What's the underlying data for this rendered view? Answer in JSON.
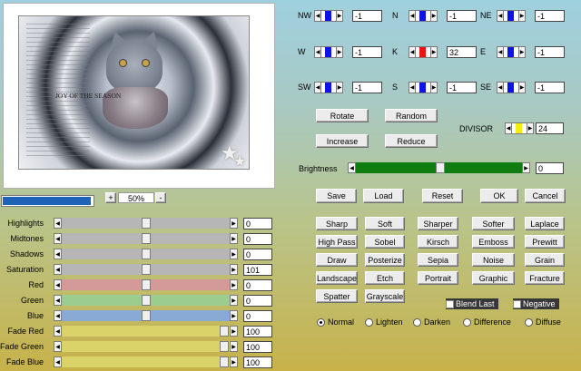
{
  "preview": {
    "art_title": "JOY OF THE SEASON",
    "progress": 0.98
  },
  "zoom": {
    "plus": "+",
    "value": "50%",
    "minus": "-"
  },
  "matrix": [
    {
      "label": "NW",
      "value": "-1",
      "thumb": "blue"
    },
    {
      "label": "N",
      "value": "-1",
      "thumb": "blue"
    },
    {
      "label": "NE",
      "value": "-1",
      "thumb": "blue"
    },
    {
      "label": "W",
      "value": "-1",
      "thumb": "blue"
    },
    {
      "label": "K",
      "value": "32",
      "thumb": "red"
    },
    {
      "label": "E",
      "value": "-1",
      "thumb": "blue"
    },
    {
      "label": "SW",
      "value": "-1",
      "thumb": "blue"
    },
    {
      "label": "S",
      "value": "-1",
      "thumb": "blue"
    },
    {
      "label": "SE",
      "value": "-1",
      "thumb": "blue"
    }
  ],
  "matrix_buttons": {
    "rotate": "Rotate",
    "random": "Random",
    "increase": "Increase",
    "reduce": "Reduce"
  },
  "divisor": {
    "label": "DIVISOR",
    "value": "24"
  },
  "brightness": {
    "label": "Brightness",
    "value": "0"
  },
  "actions": {
    "save": "Save",
    "load": "Load",
    "reset": "Reset",
    "ok": "OK",
    "cancel": "Cancel"
  },
  "presets": [
    "Sharp",
    "Soft",
    "Sharper",
    "Softer",
    "Laplace",
    "High Pass",
    "Sobel",
    "Kirsch",
    "Emboss",
    "Prewitt",
    "Draw",
    "Posterize",
    "Sepia",
    "Noise",
    "Grain",
    "Landscape",
    "Etch",
    "Portrait",
    "Graphic",
    "Fracture",
    "Spatter",
    "Grayscale"
  ],
  "options": {
    "blend_last": "Blend Last",
    "negative": "Negative"
  },
  "blend_modes": [
    "Normal",
    "Lighten",
    "Darken",
    "Difference",
    "Diffuse"
  ],
  "selected_mode": "Normal",
  "adjustments": [
    {
      "label": "Highlights",
      "value": "0",
      "level": 0.5,
      "color": "#b6b6b6"
    },
    {
      "label": "Midtones",
      "value": "0",
      "level": 0.5,
      "color": "#b6b6b6"
    },
    {
      "label": "Shadows",
      "value": "0",
      "level": 0.5,
      "color": "#b6b6b6"
    },
    {
      "label": "Saturation",
      "value": "101",
      "level": 0.5,
      "color": "#b6b6b6"
    },
    {
      "label": "Red",
      "value": "0",
      "level": 0.5,
      "color": "#d49a9a"
    },
    {
      "label": "Green",
      "value": "0",
      "level": 0.5,
      "color": "#9ccc8e"
    },
    {
      "label": "Blue",
      "value": "0",
      "level": 0.5,
      "color": "#8aaad6"
    },
    {
      "label": "Fade Red",
      "value": "100",
      "level": 0.97,
      "color": "#d9d36a"
    },
    {
      "label": "Fade Green",
      "value": "100",
      "level": 0.97,
      "color": "#d9d36a"
    },
    {
      "label": "Fade Blue",
      "value": "100",
      "level": 0.97,
      "color": "#d9d36a"
    }
  ],
  "colors": {
    "blue_thumb": "#0a14e6",
    "red_thumb": "#ee1111",
    "yellow_thumb": "#f5ee12",
    "brightness_track": "#0f7d0f",
    "progress": "#1e63b8"
  }
}
